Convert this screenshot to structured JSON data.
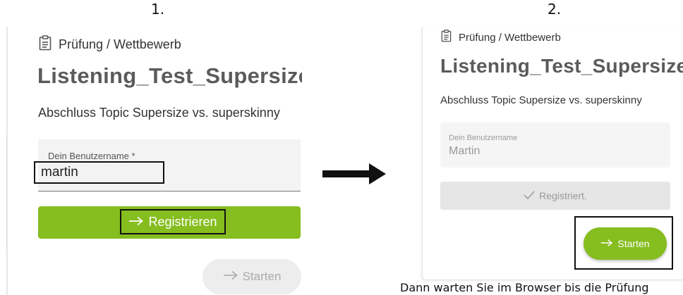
{
  "steps": {
    "first": "1.",
    "second": "2."
  },
  "panel1": {
    "header": "Prüfung / Wettbewerb",
    "header_icon": "clipboard-icon",
    "title": "Listening_Test_Supersize_vs._Superskinny",
    "subtitle": "Abschluss Topic Supersize vs. superskinny",
    "username_label": "Dein Benutzername *",
    "username_value": "martin",
    "register_label": "Registrieren",
    "register_icon": "arrow-right-icon",
    "start_label": "Starten",
    "start_icon": "arrow-right-icon",
    "accent": "#86bd1f"
  },
  "transition_icon": "arrow-right-icon",
  "panel2": {
    "header": "Prüfung / Wettbewerb",
    "title": "Listening_Test_Supersize_vs._Superskinny",
    "subtitle": "Abschluss Topic Supersize vs. superskinny",
    "username_label": "Dein Benutzername",
    "username_value": "Martin",
    "registered_label": "Registriert.",
    "registered_icon": "check-icon",
    "start_label": "Starten",
    "accent": "#86bd1f"
  },
  "caption": "Dann warten Sie im Browser bis die Prüfung"
}
